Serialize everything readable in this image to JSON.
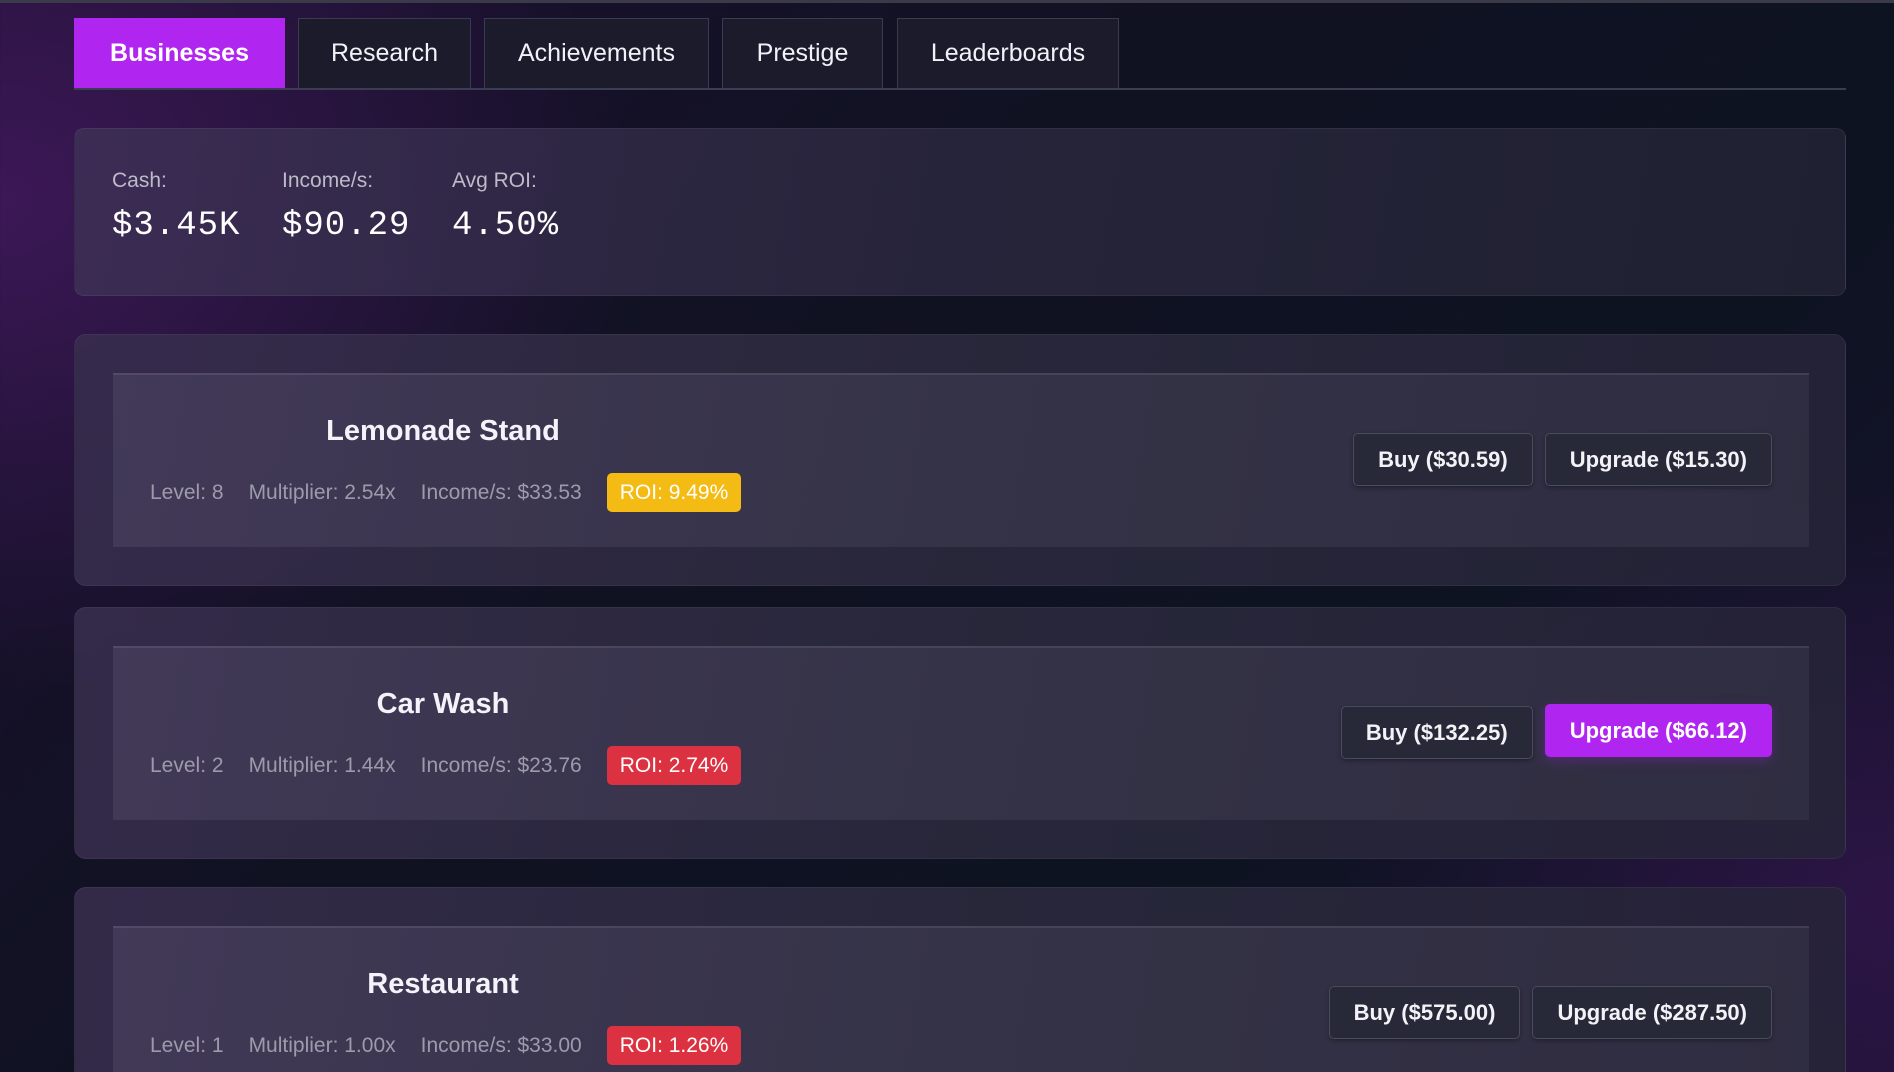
{
  "tabs": [
    {
      "label": "Businesses",
      "active": true
    },
    {
      "label": "Research",
      "active": false
    },
    {
      "label": "Achievements",
      "active": false
    },
    {
      "label": "Prestige",
      "active": false
    },
    {
      "label": "Leaderboards",
      "active": false
    }
  ],
  "stats": {
    "cash_label": "Cash:",
    "cash_value": "$3.45K",
    "income_label": "Income/s:",
    "income_value": "$90.29",
    "roi_label": "Avg ROI:",
    "roi_value": "4.50%"
  },
  "businesses": [
    {
      "name": "Lemonade Stand",
      "level": "Level: 8",
      "multiplier": "Multiplier: 2.54x",
      "income": "Income/s: $33.53",
      "roi": "ROI: 9.49%",
      "roi_status": "good",
      "buy_label": "Buy ($30.59)",
      "upgrade_label": "Upgrade ($15.30)",
      "upgrade_highlighted": false
    },
    {
      "name": "Car Wash",
      "level": "Level: 2",
      "multiplier": "Multiplier: 1.44x",
      "income": "Income/s: $23.76",
      "roi": "ROI: 2.74%",
      "roi_status": "bad",
      "buy_label": "Buy ($132.25)",
      "upgrade_label": "Upgrade ($66.12)",
      "upgrade_highlighted": true
    },
    {
      "name": "Restaurant",
      "level": "Level: 1",
      "multiplier": "Multiplier: 1.00x",
      "income": "Income/s: $33.00",
      "roi": "ROI: 1.26%",
      "roi_status": "bad",
      "buy_label": "Buy ($575.00)",
      "upgrade_label": "Upgrade ($287.50)",
      "upgrade_highlighted": false
    }
  ],
  "colors": {
    "accent": "#b026f0",
    "roi_good": "#f4bb15",
    "roi_bad": "#dc3141"
  }
}
